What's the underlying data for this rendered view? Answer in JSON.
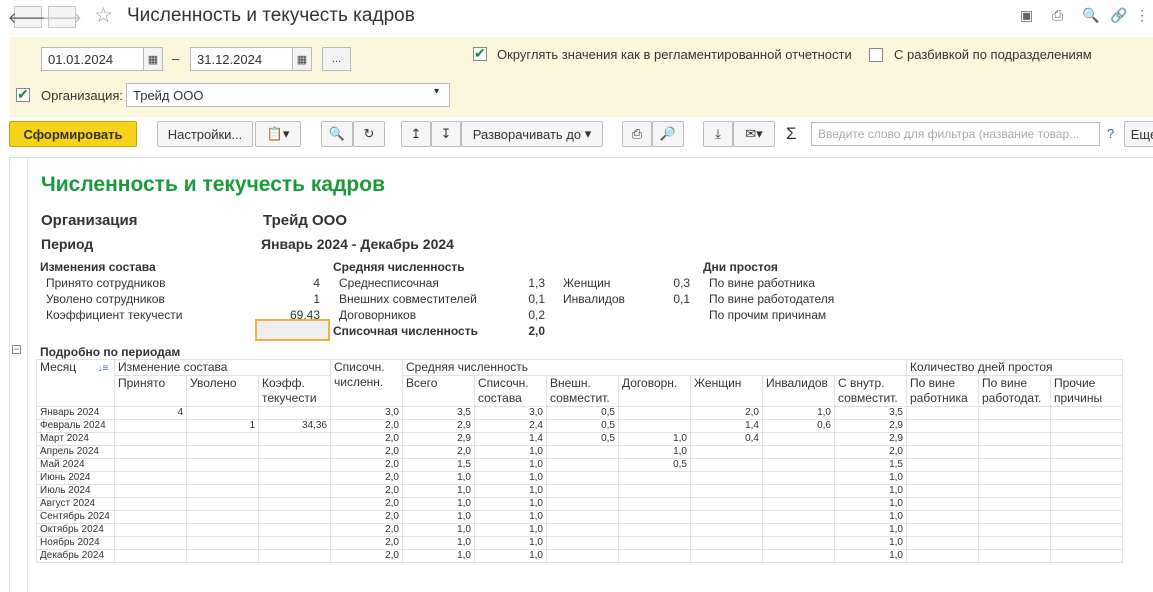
{
  "window": {
    "title": "Численность и текучесть кадров"
  },
  "filters": {
    "date_from": "01.01.2024",
    "date_to": "31.12.2024",
    "dash": "–",
    "period_button": "...",
    "round_label": "Округлять значения как в регламентированной отчетности",
    "split_label": "С разбивкой по подразделениям",
    "org_label": "Организация:",
    "org_value": "Трейд ООО"
  },
  "toolbar": {
    "generate": "Сформировать",
    "settings": "Настройки...",
    "expand": "Разворачивать до",
    "search_placeholder": "Введите слово для фильтра (название товар...",
    "help": "?",
    "more": "Еще",
    "sigma": "Σ"
  },
  "report": {
    "title": "Численность и текучесть кадров",
    "org_label": "Организация",
    "org_value": "Трейд ООО",
    "period_label": "Период",
    "period_value": "Январь 2024 - Декабрь 2024",
    "changes": {
      "heading": "Изменения состава",
      "rows": [
        {
          "label": "Принято сотрудников",
          "value": "4"
        },
        {
          "label": "Уволено сотрудников",
          "value": "1"
        },
        {
          "label": "Коэффициент текучести",
          "value": "69,43"
        }
      ]
    },
    "avg": {
      "heading": "Средняя численность",
      "rows": [
        {
          "label": "Среднесписочная",
          "value": "1,3"
        },
        {
          "label": "Внешних совместителей",
          "value": "0,1"
        },
        {
          "label": "Договорников",
          "value": "0,2"
        }
      ],
      "total_label": "Списочная численность",
      "total_value": "2,0"
    },
    "women": {
      "label": "Женщин",
      "value": "0,3"
    },
    "invalids": {
      "label": "Инвалидов",
      "value": "0,1"
    },
    "idle": {
      "heading": "Дни простоя",
      "rows": [
        "По вине работника",
        "По вине работодателя",
        "По прочим причинам"
      ]
    },
    "details_heading": "Подробно по периодам",
    "table": {
      "h_month": "Месяц",
      "h_changes": "Изменение состава",
      "h_list": "Списочн. численн.",
      "h_avg": "Средняя численность",
      "h_idle": "Количество дней простоя",
      "sub": [
        "Принято",
        "Уволено",
        "Коэфф. текучести",
        "Всего",
        "Списочн. состава",
        "Внешн. совместит.",
        "Договорн.",
        "Женщин",
        "Инвалидов",
        "С внутр. совместит.",
        "По вине работника",
        "По вине работодат.",
        "Прочие причины"
      ],
      "rows": [
        [
          "Январь 2024",
          "4",
          "",
          "",
          "3,0",
          "3,5",
          "3,0",
          "0,5",
          "",
          "2,0",
          "1,0",
          "3,5",
          "",
          "",
          ""
        ],
        [
          "Февраль 2024",
          "",
          "1",
          "34,36",
          "2,0",
          "2,9",
          "2,4",
          "0,5",
          "",
          "1,4",
          "0,6",
          "2,9",
          "",
          "",
          ""
        ],
        [
          "Март 2024",
          "",
          "",
          "",
          "2,0",
          "2,9",
          "1,4",
          "0,5",
          "1,0",
          "0,4",
          "",
          "2,9",
          "",
          "",
          ""
        ],
        [
          "Апрель 2024",
          "",
          "",
          "",
          "2,0",
          "2,0",
          "1,0",
          "",
          "1,0",
          "",
          "",
          "2,0",
          "",
          "",
          ""
        ],
        [
          "Май 2024",
          "",
          "",
          "",
          "2,0",
          "1,5",
          "1,0",
          "",
          "0,5",
          "",
          "",
          "1,5",
          "",
          "",
          ""
        ],
        [
          "Июнь 2024",
          "",
          "",
          "",
          "2,0",
          "1,0",
          "1,0",
          "",
          "",
          "",
          "",
          "1,0",
          "",
          "",
          ""
        ],
        [
          "Июль 2024",
          "",
          "",
          "",
          "2,0",
          "1,0",
          "1,0",
          "",
          "",
          "",
          "",
          "1,0",
          "",
          "",
          ""
        ],
        [
          "Август 2024",
          "",
          "",
          "",
          "2,0",
          "1,0",
          "1,0",
          "",
          "",
          "",
          "",
          "1,0",
          "",
          "",
          ""
        ],
        [
          "Сентябрь 2024",
          "",
          "",
          "",
          "2,0",
          "1,0",
          "1,0",
          "",
          "",
          "",
          "",
          "1,0",
          "",
          "",
          ""
        ],
        [
          "Октябрь 2024",
          "",
          "",
          "",
          "2,0",
          "1,0",
          "1,0",
          "",
          "",
          "",
          "",
          "1,0",
          "",
          "",
          ""
        ],
        [
          "Ноябрь 2024",
          "",
          "",
          "",
          "2,0",
          "1,0",
          "1,0",
          "",
          "",
          "",
          "",
          "1,0",
          "",
          "",
          ""
        ],
        [
          "Декабрь 2024",
          "",
          "",
          "",
          "2,0",
          "1,0",
          "1,0",
          "",
          "",
          "",
          "",
          "1,0",
          "",
          "",
          ""
        ]
      ]
    }
  }
}
